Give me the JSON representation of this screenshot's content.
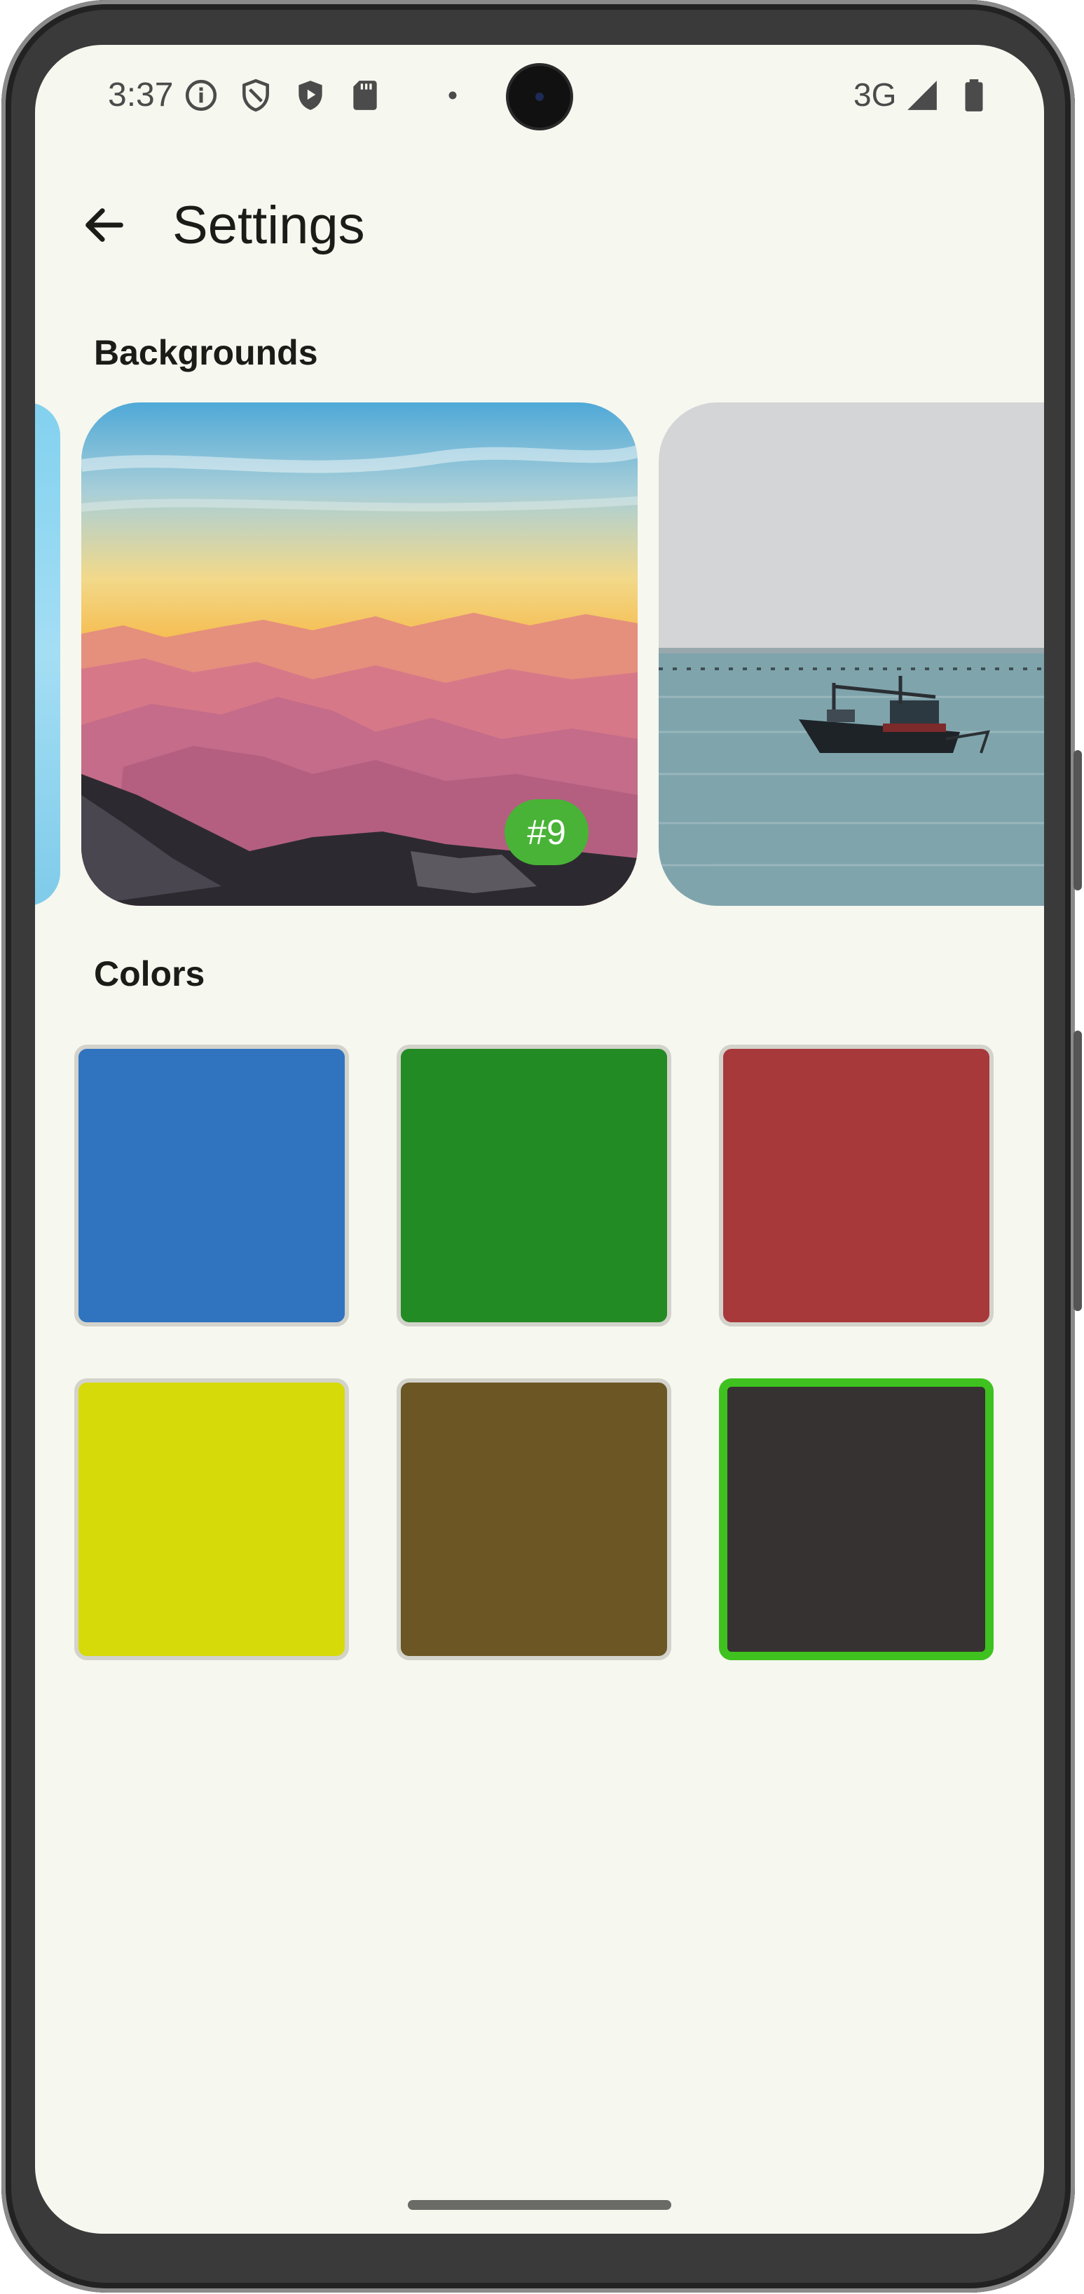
{
  "status_bar": {
    "time": "3:37",
    "network": "3G",
    "icons": [
      "info-icon",
      "shield-icon",
      "play-shield-icon",
      "sd-card-icon",
      "dot-icon",
      "signal-icon",
      "battery-icon"
    ]
  },
  "app_bar": {
    "title": "Settings",
    "back_icon": "arrow-back-icon"
  },
  "backgrounds": {
    "heading": "Backgrounds",
    "items": [
      {
        "name": "sky-background",
        "selected": false
      },
      {
        "name": "mountain-sunset-background",
        "badge": "#9",
        "selected": true
      },
      {
        "name": "boat-sea-background",
        "selected": false
      }
    ]
  },
  "colors": {
    "heading": "Colors",
    "swatches": [
      {
        "name": "blue",
        "hex": "#3074bf",
        "selected": false
      },
      {
        "name": "green",
        "hex": "#238b24",
        "selected": false
      },
      {
        "name": "red",
        "hex": "#a8393a",
        "selected": false
      },
      {
        "name": "yellow",
        "hex": "#d6da08",
        "selected": false
      },
      {
        "name": "brown",
        "hex": "#6b5624",
        "selected": false
      },
      {
        "name": "dark-gray",
        "hex": "#363232",
        "selected": true
      }
    ],
    "selection_border": "#3fc21f"
  }
}
